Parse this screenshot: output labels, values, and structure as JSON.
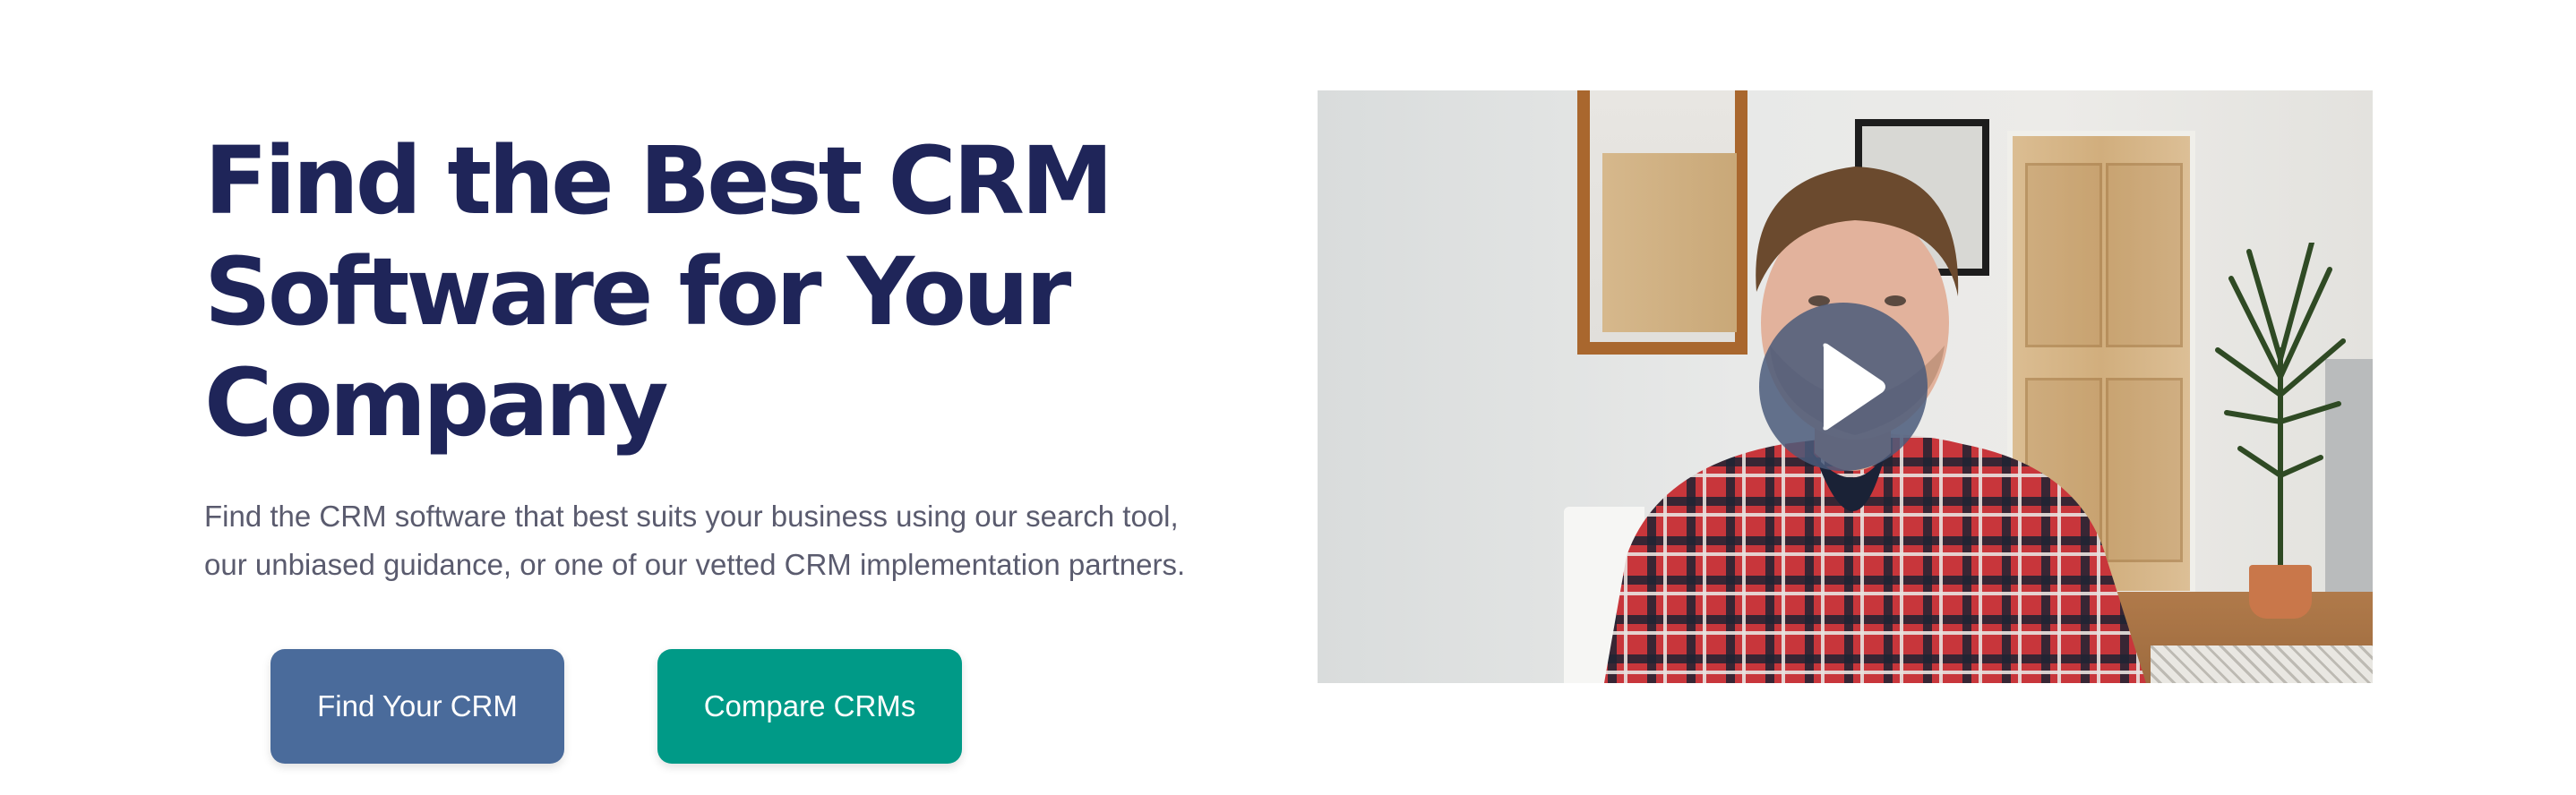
{
  "hero": {
    "title": "Find the Best CRM\nSoftware for Your\nCompany",
    "subtitle": "Find the CRM software that best suits your business using our search tool, our unbiased guidance, or one of our vetted CRM implementation partners."
  },
  "buttons": {
    "find_label": "Find Your CRM",
    "compare_label": "Compare CRMs"
  },
  "video": {
    "play_icon": "play-icon"
  },
  "colors": {
    "title": "#1f2559",
    "subtitle": "#5a5b6e",
    "find_button": "#4a6b9b",
    "compare_button": "#009a87",
    "play_button": "#4a5a7a"
  }
}
